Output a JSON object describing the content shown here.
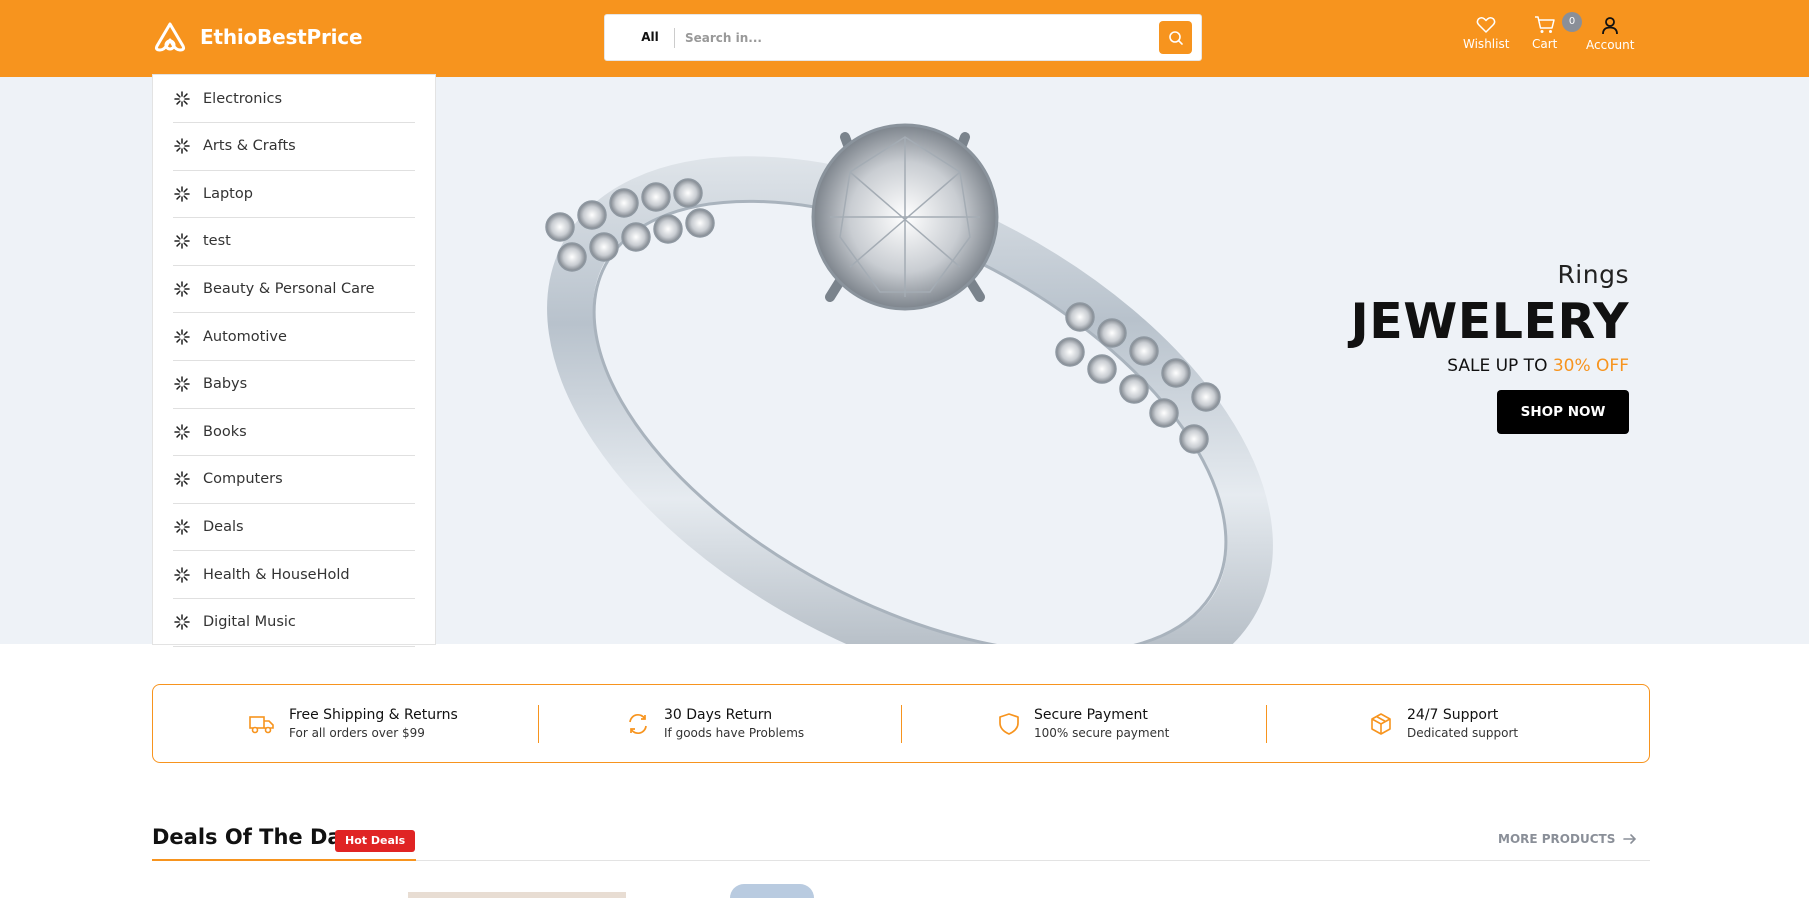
{
  "header": {
    "brand": "EthioBestPrice",
    "search": {
      "category": "All",
      "placeholder": "Search in..."
    },
    "actions": [
      {
        "label": "Wishlist",
        "icon": "heart-icon"
      },
      {
        "label": "Cart",
        "icon": "cart-icon",
        "badge": "0"
      },
      {
        "label": "Account",
        "icon": "user-icon"
      }
    ]
  },
  "sidebar": {
    "items": [
      {
        "label": "Electronics"
      },
      {
        "label": "Arts & Crafts"
      },
      {
        "label": "Laptop"
      },
      {
        "label": "test"
      },
      {
        "label": "Beauty & Personal Care"
      },
      {
        "label": "Automotive"
      },
      {
        "label": "Babys"
      },
      {
        "label": "Books"
      },
      {
        "label": "Computers"
      },
      {
        "label": "Deals"
      },
      {
        "label": "Health & HouseHold"
      },
      {
        "label": "Digital Music"
      }
    ]
  },
  "hero": {
    "subtitle": "Rings",
    "title": "JEWELERY",
    "sale_prefix": "SALE UP TO",
    "sale_highlight": "30% OFF",
    "button": "SHOP NOW",
    "slides": 5,
    "active_slide": 1
  },
  "features": [
    {
      "title": "Free Shipping & Returns",
      "subtitle": "For all orders over $99",
      "icon": "truck-icon"
    },
    {
      "title": "30 Days Return",
      "subtitle": "If goods have Problems",
      "icon": "refresh-icon"
    },
    {
      "title": "Secure Payment",
      "subtitle": "100% secure payment",
      "icon": "shield-icon"
    },
    {
      "title": "24/7 Support",
      "subtitle": "Dedicated support",
      "icon": "box-icon"
    }
  ],
  "deals": {
    "title": "Deals Of The Day",
    "badge": "Hot Deals",
    "more": "MORE PRODUCTS"
  },
  "colors": {
    "accent": "#f7941e",
    "hero_bg": "#eef2f7",
    "badge_red": "#e02424",
    "dot_active": "#1e6fe0"
  }
}
